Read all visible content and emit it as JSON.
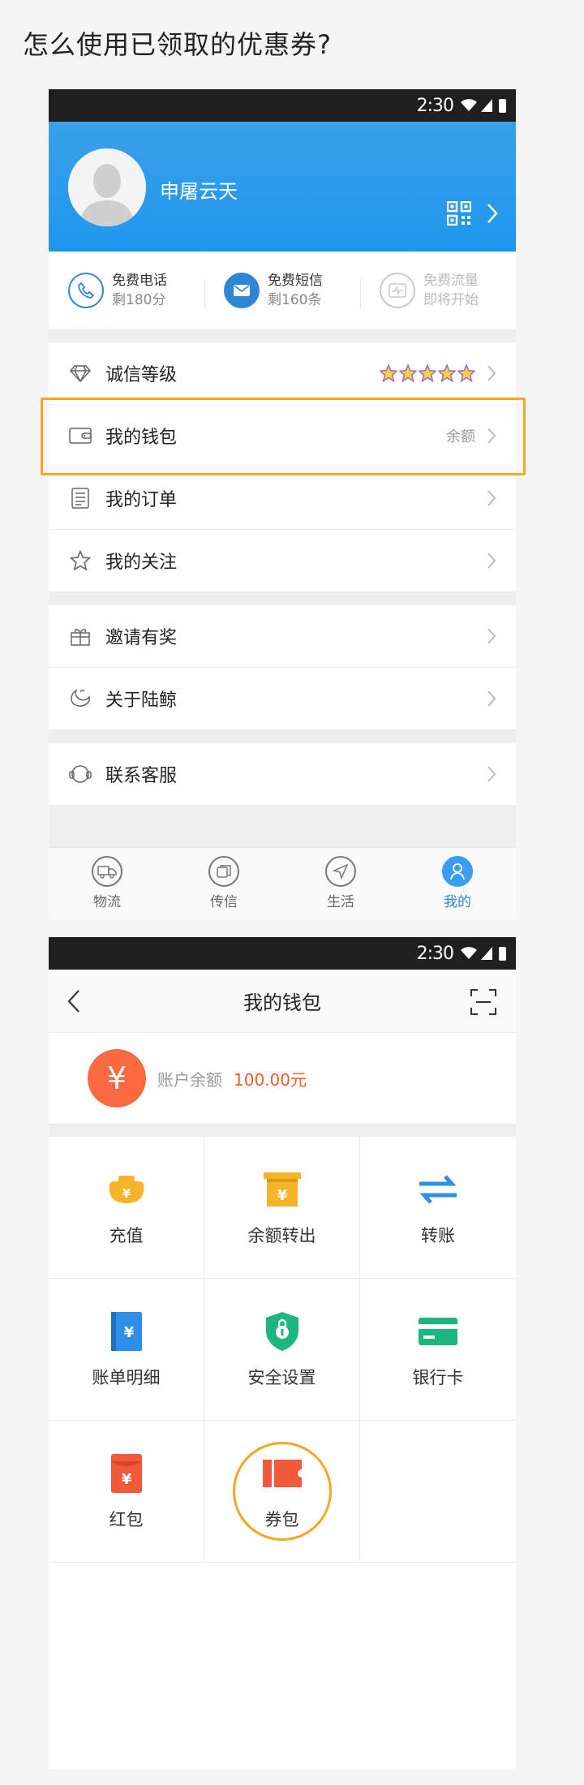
{
  "question": "怎么使用已领取的优惠券?",
  "status_bar": {
    "time": "2:30"
  },
  "profile": {
    "username": "申屠云天"
  },
  "stats": [
    {
      "title": "免费电话",
      "sub": "剩180分",
      "icon": "phone-icon"
    },
    {
      "title": "免费短信",
      "sub": "剩160条",
      "icon": "message-icon"
    },
    {
      "title": "免费流量",
      "sub": "即将开始",
      "icon": "traffic-icon"
    }
  ],
  "menu": {
    "credit": {
      "label": "诚信等级",
      "stars": 5
    },
    "wallet": {
      "label": "我的钱包",
      "right": "余额"
    },
    "orders": {
      "label": "我的订单"
    },
    "follow": {
      "label": "我的关注"
    },
    "invite": {
      "label": "邀请有奖"
    },
    "about": {
      "label": "关于陆鲸"
    },
    "service": {
      "label": "联系客服"
    }
  },
  "tabs": [
    {
      "label": "物流",
      "icon": "truck-icon",
      "active": false
    },
    {
      "label": "传信",
      "icon": "chat-icon",
      "active": false
    },
    {
      "label": "生活",
      "icon": "compass-icon",
      "active": false
    },
    {
      "label": "我的",
      "icon": "person-icon",
      "active": true
    }
  ],
  "wallet": {
    "title": "我的钱包",
    "balance_symbol": "¥",
    "balance_label": "账户余额",
    "balance_value": "100.00元",
    "items": [
      {
        "label": "充值",
        "icon": "gold-ingot-icon"
      },
      {
        "label": "余额转出",
        "icon": "transfer-out-icon"
      },
      {
        "label": "转账",
        "icon": "swap-arrows-icon"
      },
      {
        "label": "账单明细",
        "icon": "bill-icon"
      },
      {
        "label": "安全设置",
        "icon": "shield-lock-icon"
      },
      {
        "label": "银行卡",
        "icon": "bank-card-icon"
      },
      {
        "label": "红包",
        "icon": "red-packet-icon"
      },
      {
        "label": "券包",
        "icon": "coupon-icon"
      }
    ]
  },
  "colors": {
    "accent": "#1e97ee",
    "highlight": "#f5a623",
    "balance": "#f25a28"
  }
}
